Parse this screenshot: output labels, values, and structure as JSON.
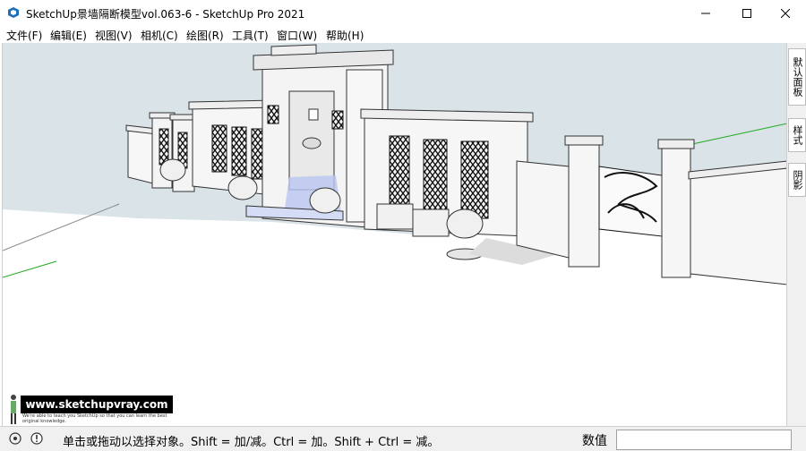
{
  "window": {
    "title": "SketchUp景墙隔断模型vol.063-6 - SketchUp Pro 2021",
    "controls": [
      "minimize-icon",
      "maximize-icon",
      "close-icon"
    ]
  },
  "menu": {
    "items": [
      "文件(F)",
      "编辑(E)",
      "视图(V)",
      "相机(C)",
      "绘图(R)",
      "工具(T)",
      "窗口(W)",
      "帮助(H)"
    ]
  },
  "tray": {
    "tabs": [
      "默认面板",
      "样式",
      "阴影"
    ]
  },
  "watermark": {
    "url": "www.sketchupvray.com",
    "subtitle": "We're able to teach you SketchUp so that you can learn the best original knowledge."
  },
  "status": {
    "message": "单击或拖动以选择对象。Shift = 加/减。Ctrl = 加。Shift + Ctrl = 减。",
    "measurements_label": "数值",
    "measurements_value": ""
  },
  "colors": {
    "sky": "#d9e3e8",
    "ground": "#ffffff",
    "axis_green": "#22aa22",
    "water": "#b9c6f0"
  }
}
